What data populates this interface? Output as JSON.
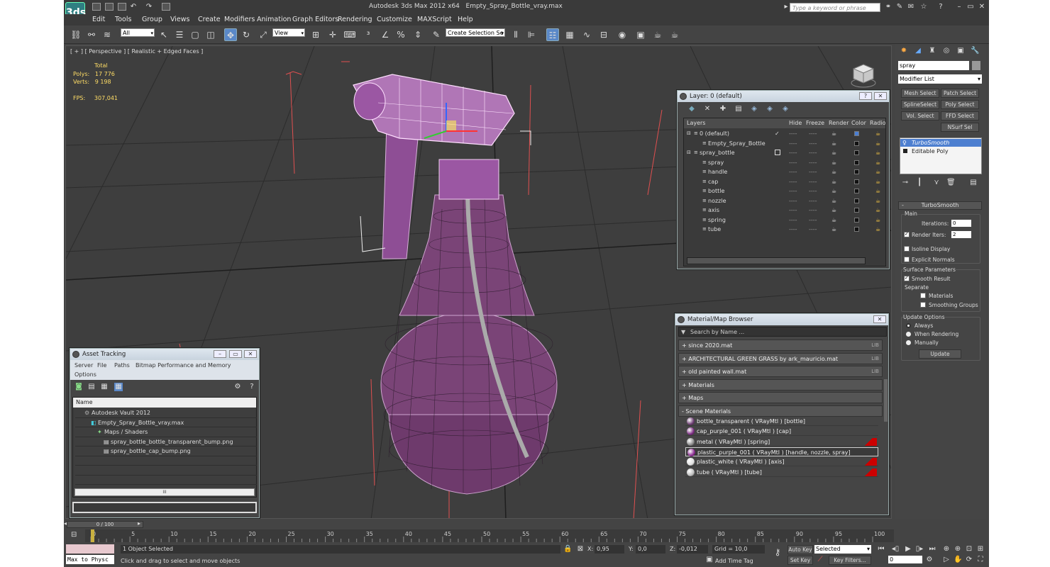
{
  "app": {
    "title": "Autodesk 3ds Max  2012 x64",
    "file": "Empty_Spray_Bottle_vray.max",
    "search_placeholder": "Type a keyword or phrase",
    "logo": "3ds"
  },
  "menu": [
    "Edit",
    "Tools",
    "Group",
    "Views",
    "Create",
    "Modifiers",
    "Animation",
    "Graph Editors",
    "Rendering",
    "Customize",
    "MAXScript",
    "Help"
  ],
  "toolbar": {
    "filter": "All",
    "refcoord": "View",
    "selset": "Create Selection Se"
  },
  "viewport": {
    "label": "[ + ] [ Perspective ] [ Realistic + Edged Faces ]",
    "stats": {
      "total_label": "Total",
      "polys_label": "Polys:",
      "polys": "17 776",
      "verts_label": "Verts:",
      "verts": "9 198",
      "fps_label": "FPS:",
      "fps": "307,041"
    }
  },
  "layer_window": {
    "title": "Layer: 0 (default)",
    "headers": [
      "Layers",
      "Hide",
      "Freeze",
      "Render",
      "Color",
      "Radio"
    ],
    "rows": [
      {
        "name": "0 (default)",
        "indent": 0,
        "color": "#4a7fd4",
        "current": true
      },
      {
        "name": "Empty_Spray_Bottle",
        "indent": 1,
        "color": "#111"
      },
      {
        "name": "spray_bottle",
        "indent": 0,
        "color": "#111"
      },
      {
        "name": "spray",
        "indent": 1,
        "color": "#111"
      },
      {
        "name": "handle",
        "indent": 1,
        "color": "#111"
      },
      {
        "name": "cap",
        "indent": 1,
        "color": "#111"
      },
      {
        "name": "bottle",
        "indent": 1,
        "color": "#111"
      },
      {
        "name": "nozzle",
        "indent": 1,
        "color": "#111"
      },
      {
        "name": "axis",
        "indent": 1,
        "color": "#111"
      },
      {
        "name": "spring",
        "indent": 1,
        "color": "#111"
      },
      {
        "name": "tube",
        "indent": 1,
        "color": "#111"
      }
    ],
    "dash": "----",
    "check": "✓"
  },
  "material_browser": {
    "title": "Material/Map Browser",
    "search": "Search by Name ...",
    "groups": [
      {
        "name": "+ since 2020.mat",
        "lib": "LIB"
      },
      {
        "name": "+ ARCHITECTURAL GREEN GRASS by ark_mauricio.mat",
        "lib": "LIB"
      },
      {
        "name": "+ old painted wall.mat",
        "lib": "LIB"
      },
      {
        "name": "+ Materials",
        "lib": ""
      },
      {
        "name": "+ Maps",
        "lib": ""
      },
      {
        "name": "- Scene Materials",
        "lib": ""
      }
    ],
    "materials": [
      {
        "name": "bottle_transparent  ( VRayMtl )  [bottle]",
        "color": "#6a3a70",
        "red": false
      },
      {
        "name": "cap_purple_001  ( VRayMtl )  [cap]",
        "color": "#7a2a80",
        "red": false
      },
      {
        "name": "metal  ( VRayMtl )  [spring]",
        "color": "#888",
        "red": true
      },
      {
        "name": "plastic_purple_001  ( VRayMtl )  [handle, nozzle, spray]",
        "color": "#8a2a90",
        "red": false,
        "selected": true
      },
      {
        "name": "plastic_white  ( VRayMtl )  [axis]",
        "color": "#ddd",
        "red": true
      },
      {
        "name": "tube  ( VRayMtl )  [tube]",
        "color": "#bbb",
        "red": true
      }
    ]
  },
  "asset_tracking": {
    "title": "Asset Tracking",
    "menu": [
      "Server",
      "File",
      "Paths",
      "Bitmap Performance and Memory"
    ],
    "menu2": "Options",
    "column": "Name",
    "rows": [
      {
        "name": "Autodesk Vault 2012",
        "indent": 1
      },
      {
        "name": "Empty_Spray_Bottle_vray.max",
        "indent": 2
      },
      {
        "name": "Maps / Shaders",
        "indent": 3
      },
      {
        "name": "spray_bottle_bottle_transparent_bump.png",
        "indent": 4
      },
      {
        "name": "spray_bottle_cap_bump.png",
        "indent": 4
      }
    ],
    "scroll": "III"
  },
  "command_panel": {
    "object_name": "spray",
    "modifier_list": "Modifier List",
    "buttons": [
      "Mesh Select",
      "Patch Select",
      "SplineSelect",
      "Poly Select",
      "Vol. Select",
      "FFD Select",
      "NSurf Sel"
    ],
    "stack": [
      "TurboSmooth",
      "Editable Poly"
    ],
    "rollout": "TurboSmooth",
    "main": "Main",
    "iterations_label": "Iterations:",
    "iterations": "0",
    "render_iters_label": "Render Iters:",
    "render_iters": "2",
    "isoline": "Isoline Display",
    "explicit": "Explicit Normals",
    "surface": "Surface Parameters",
    "smooth": "Smooth Result",
    "separate": "Separate",
    "materials": "Materials",
    "smoothing": "Smoothing Groups",
    "update_options": "Update Options",
    "always": "Always",
    "when_rendering": "When Rendering",
    "manually": "Manually",
    "update": "Update"
  },
  "timeline": {
    "frame": "0 / 100",
    "ticks": [
      "0",
      "5",
      "10",
      "15",
      "20",
      "25",
      "30",
      "35",
      "40",
      "45",
      "50",
      "55",
      "60",
      "65",
      "70",
      "75",
      "80",
      "85",
      "90",
      "95",
      "100"
    ]
  },
  "status": {
    "script": "Max to Physc",
    "selected": "1 Object Selected",
    "prompt": "Click and drag to select and move objects",
    "x_label": "X:",
    "x": "0,95",
    "y_label": "Y:",
    "y": "0,0",
    "z_label": "Z:",
    "z": "-0,012",
    "grid": "Grid = 10,0",
    "autokey": "Auto Key",
    "setkey": "Set Key",
    "selected_dd": "Selected",
    "keyfilters": "Key Filters...",
    "addtimetag": "Add Time Tag",
    "frame_field": "0"
  }
}
